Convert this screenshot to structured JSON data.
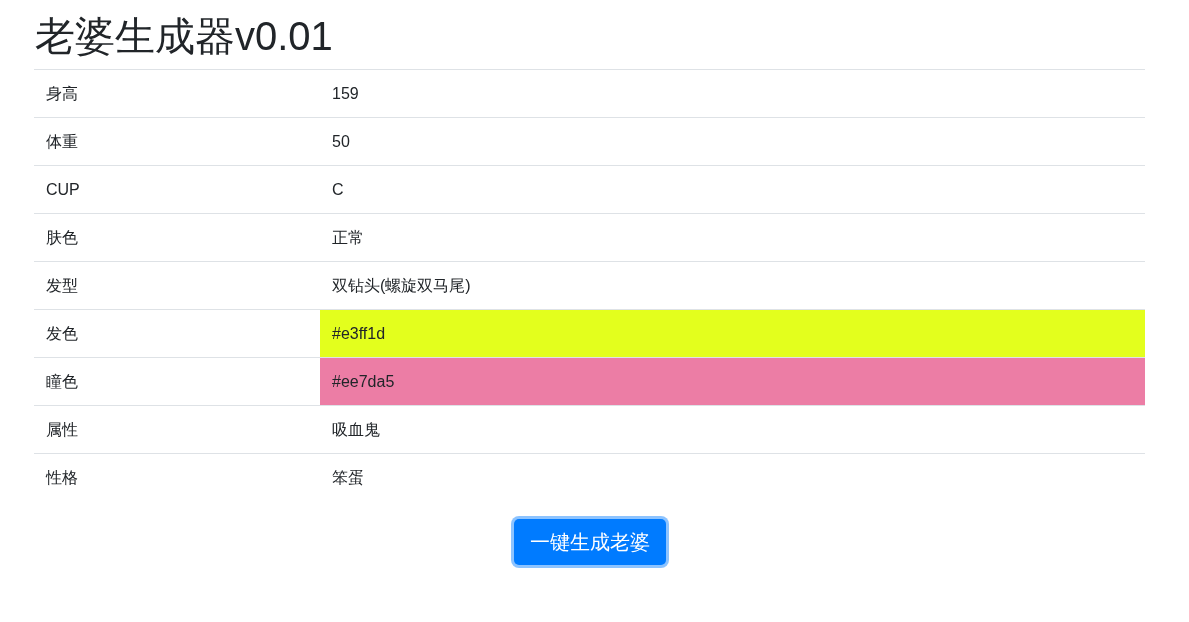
{
  "title": "老婆生成器v0.01",
  "table": {
    "rows": [
      {
        "label": "身高",
        "value": "159"
      },
      {
        "label": "体重",
        "value": "50"
      },
      {
        "label": "CUP",
        "value": "C"
      },
      {
        "label": "肤色",
        "value": "正常"
      },
      {
        "label": "发型",
        "value": "双钻头(螺旋双马尾)"
      },
      {
        "label": "发色",
        "value": "#e3ff1d",
        "color": "#e3ff1d"
      },
      {
        "label": "瞳色",
        "value": "#ee7da5",
        "color": "#ec7da5"
      },
      {
        "label": "属性",
        "value": "吸血鬼"
      },
      {
        "label": "性格",
        "value": "笨蛋"
      }
    ]
  },
  "generate_button": {
    "label": "一键生成老婆",
    "focused": true
  }
}
